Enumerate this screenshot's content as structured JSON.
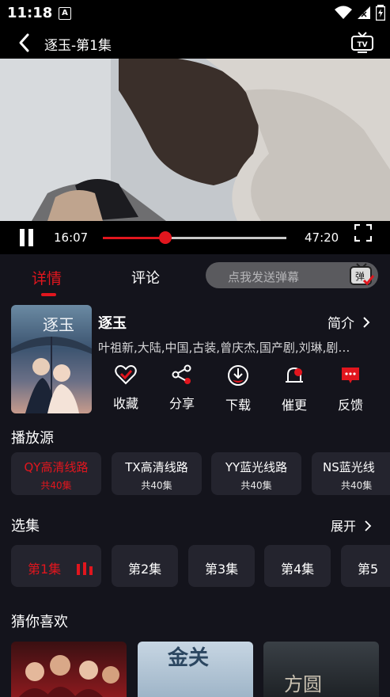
{
  "status": {
    "time": "11:18",
    "notif_letter": "A"
  },
  "header": {
    "title": "逐玉-第1集",
    "back_icon": "chevron-left-icon",
    "tv_icon": "tv-cast-icon"
  },
  "player": {
    "current_time": "16:07",
    "total_time": "47:20",
    "progress": 0.34,
    "state": "playing"
  },
  "tabs": {
    "detail": "详情",
    "comment": "评论",
    "active": "detail"
  },
  "danmaku": {
    "placeholder": "点我发送弹幕",
    "icon_label": "弹"
  },
  "show": {
    "title": "逐玉",
    "intro_label": "简介",
    "tags": "叶祖新,大陆,中国,古装,曾庆杰,国产剧,刘琳,剧…",
    "poster_text": "逐玉"
  },
  "actions": [
    {
      "label": "收藏",
      "icon": "heart-icon"
    },
    {
      "label": "分享",
      "icon": "share-icon"
    },
    {
      "label": "下载",
      "icon": "download-icon"
    },
    {
      "label": "催更",
      "icon": "bell-icon"
    },
    {
      "label": "反馈",
      "icon": "feedback-icon"
    }
  ],
  "sources_title": "播放源",
  "sources": [
    {
      "name": "QY高清线路",
      "count": "共40集",
      "active": true
    },
    {
      "name": "TX高清线路",
      "count": "共40集",
      "active": false
    },
    {
      "name": "YY蓝光线路",
      "count": "共40集",
      "active": false
    },
    {
      "name": "NS蓝光线",
      "count": "共40集",
      "active": false
    }
  ],
  "episodes_title": "选集",
  "episodes_expand": "展开",
  "episodes": [
    "第1集",
    "第2集",
    "第3集",
    "第4集",
    "第5"
  ],
  "recommend_title": "猜你喜欢",
  "recommend_texts": {
    "item2": "金关",
    "item3": "方圆"
  },
  "colors": {
    "accent": "#e1161e",
    "background": "#14141c",
    "card": "#24242e"
  }
}
